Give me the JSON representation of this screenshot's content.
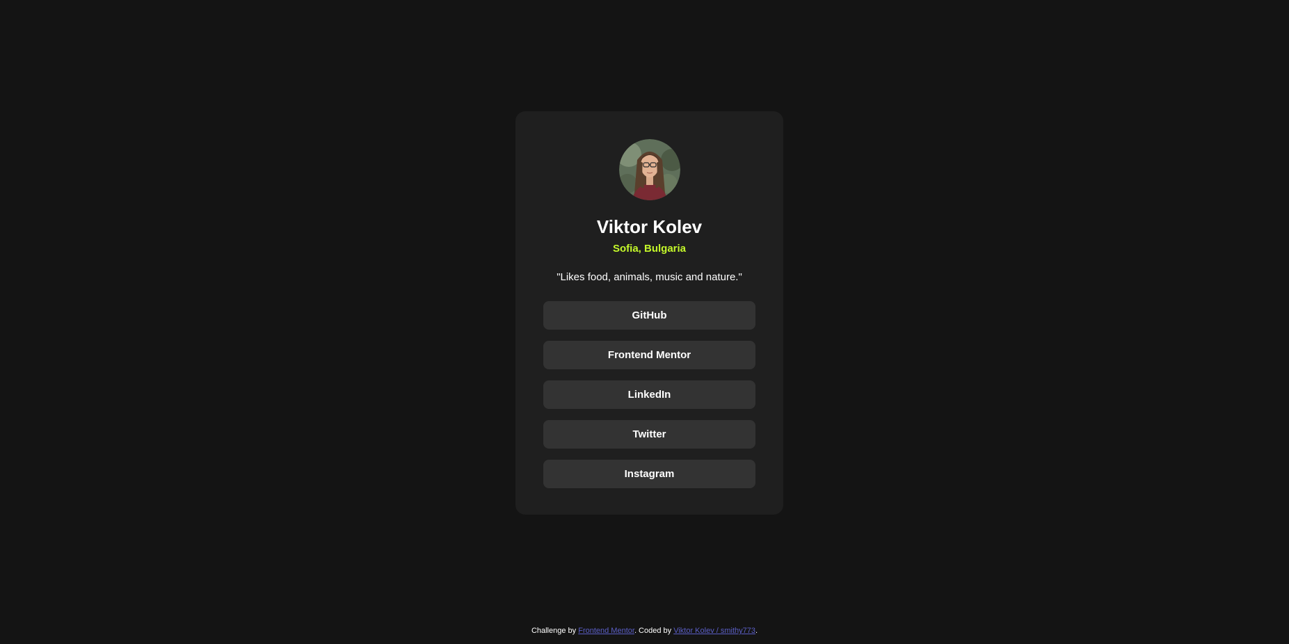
{
  "profile": {
    "avatar_icon": "user-portrait-photo",
    "name": "Viktor Kolev",
    "location": "Sofia, Bulgaria",
    "bio": "\"Likes food, animals, music and nature.\""
  },
  "links": [
    {
      "label": "GitHub"
    },
    {
      "label": "Frontend Mentor"
    },
    {
      "label": "LinkedIn"
    },
    {
      "label": "Twitter"
    },
    {
      "label": "Instagram"
    }
  ],
  "footer": {
    "challenge_prefix": "Challenge by ",
    "challenge_link": "Frontend Mentor",
    "coded_prefix": ". Coded by ",
    "coded_link": "Viktor Kolev / smithy773",
    "suffix": "."
  },
  "colors": {
    "background": "#141414",
    "card": "#1f1f1f",
    "button": "#333333",
    "accent": "#c4f82a",
    "link": "#5b5fc7"
  }
}
